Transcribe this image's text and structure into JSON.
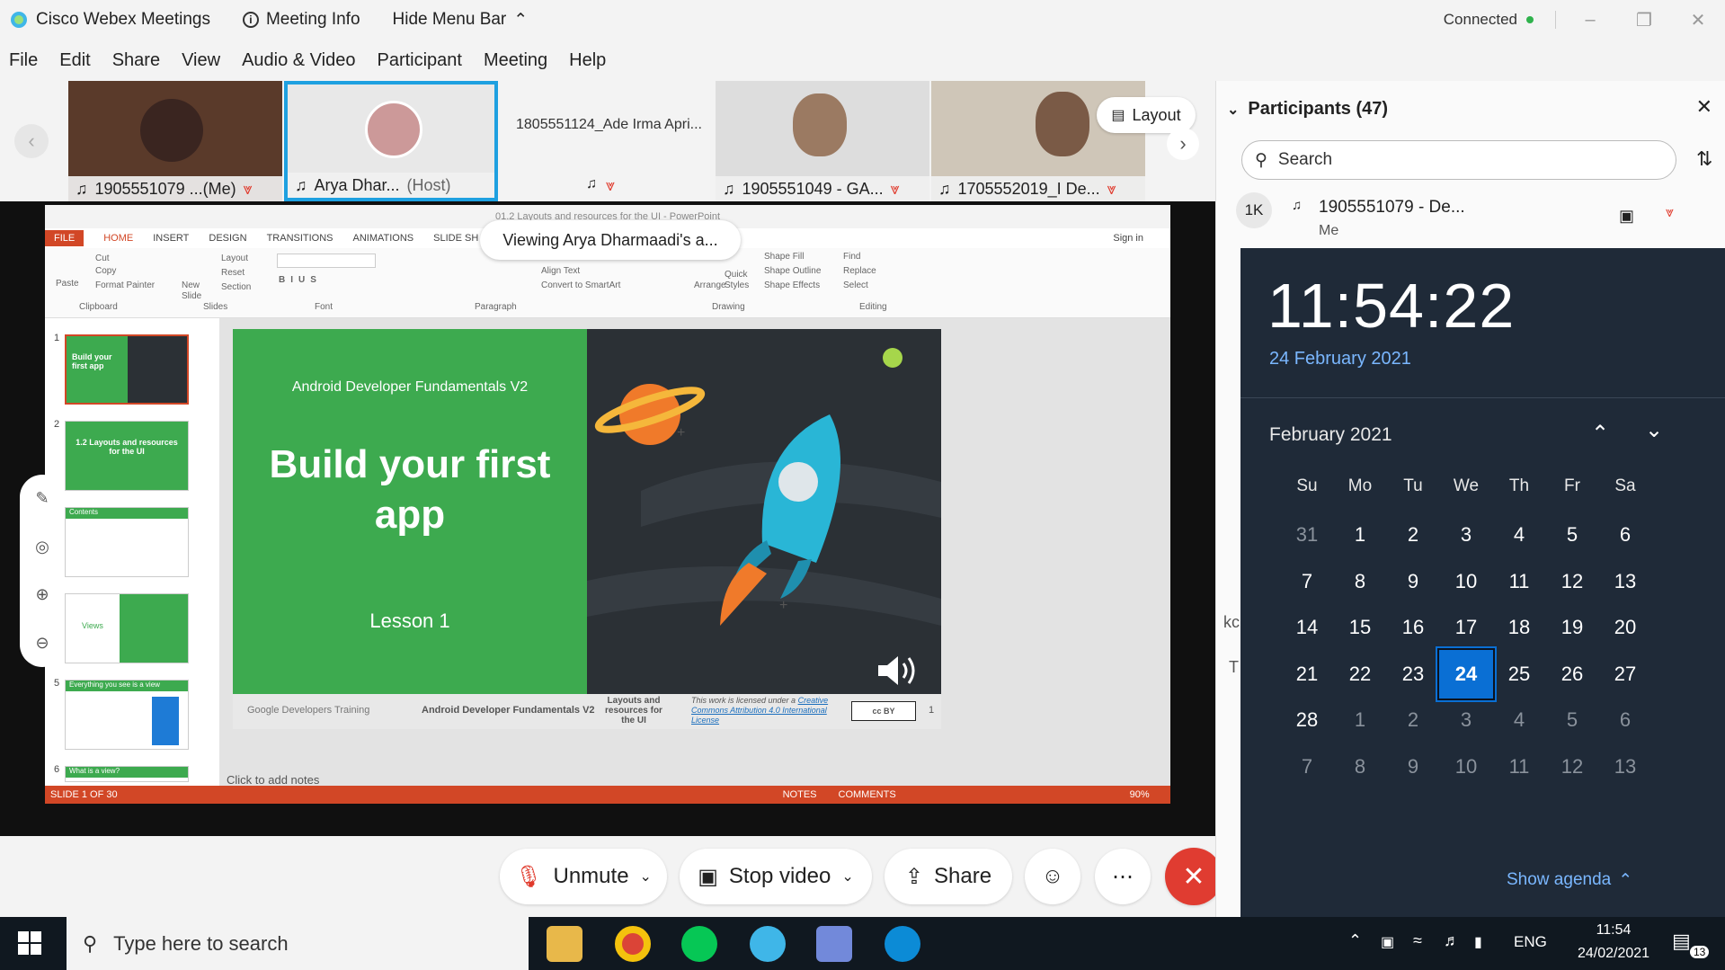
{
  "titlebar": {
    "app_name": "Cisco Webex Meetings",
    "meeting_info": "Meeting Info",
    "hide_menu": "Hide Menu Bar",
    "status": "Connected",
    "status_color": "#2fb24c"
  },
  "menubar": {
    "items": [
      "File",
      "Edit",
      "Share",
      "View",
      "Audio & Video",
      "Participant",
      "Meeting",
      "Help"
    ]
  },
  "videostrip": {
    "tiles": [
      {
        "name": "1905551079 ...(Me)",
        "muted": true
      },
      {
        "name": "Arya Dhar...",
        "role": "(Host)",
        "muted": false,
        "active": true
      },
      {
        "name": "1805551124_Ade Irma Apri...",
        "muted": true,
        "no_video": true
      },
      {
        "name": "1905551049 - GA...",
        "muted": true
      },
      {
        "name": "1705552019_I De...",
        "muted": true
      }
    ],
    "layout_label": "Layout"
  },
  "viewing_banner": "Viewing Arya Dharmaadi's a...",
  "ppt": {
    "window_title": "01.2 Layouts and resources for the UI - PowerPoint",
    "signin": "Sign in",
    "tabs": [
      "FILE",
      "HOME",
      "INSERT",
      "DESIGN",
      "TRANSITIONS",
      "ANIMATIONS",
      "SLIDE SH"
    ],
    "groups": {
      "clipboard": "Clipboard",
      "slides": "Slides",
      "font": "Font",
      "paragraph": "Paragraph",
      "drawing": "Drawing",
      "editing": "Editing"
    },
    "clipboard_items": {
      "paste": "Paste",
      "cut": "Cut",
      "copy": "Copy",
      "format_painter": "Format Painter"
    },
    "slides_items": {
      "new_slide": "New Slide",
      "layout": "Layout",
      "reset": "Reset",
      "section": "Section"
    },
    "paragraph_items": {
      "align_text": "Align Text",
      "convert_smartart": "Convert to SmartArt"
    },
    "drawing_items": {
      "arrange": "Arrange",
      "quick_styles": "Quick Styles",
      "shape_fill": "Shape Fill",
      "shape_outline": "Shape Outline",
      "shape_effects": "Shape Effects"
    },
    "editing_items": {
      "find": "Find",
      "replace": "Replace",
      "select": "Select"
    },
    "slide": {
      "course": "Android Developer Fundamentals V2",
      "title_line1": "Build your first",
      "title_line2": "app",
      "lesson": "Lesson 1",
      "footer_brand": "Google Developers Training",
      "footer_course": "Android Developer Fundamentals V2",
      "footer_topic": "Layouts and resources for the UI",
      "footer_license_prefix": "This work is licensed under a",
      "footer_license_link": "Creative Commons Attribution 4.0 International License",
      "page_number": "1"
    },
    "thumbs": [
      {
        "num": "1",
        "title": "Build your first app"
      },
      {
        "num": "2",
        "title": "1.2 Layouts and resources for the UI"
      },
      {
        "num": "",
        "title": "Contents"
      },
      {
        "num": "",
        "title": "Views"
      },
      {
        "num": "5",
        "title": "Everything you see is a view"
      },
      {
        "num": "6",
        "title": "What is a view?"
      }
    ],
    "notes_placeholder": "Click to add notes",
    "status": {
      "slide_of": "SLIDE 1 OF 30",
      "notes": "NOTES",
      "comments": "COMMENTS",
      "zoom": "90%"
    }
  },
  "controls": {
    "unmute": "Unmute",
    "stop_video": "Stop video",
    "share": "Share",
    "leave_color": "#e03c31"
  },
  "participants": {
    "header": "Participants (47)",
    "search_placeholder": "Search",
    "first": {
      "initials": "1K",
      "name": "1905551079 - De...",
      "sub": "Me"
    },
    "partial_texts": [
      "kc",
      "T"
    ]
  },
  "calendar": {
    "time": "11:54:22",
    "date": "24 February 2021",
    "month": "February 2021",
    "weekdays": [
      "Su",
      "Mo",
      "Tu",
      "We",
      "Th",
      "Fr",
      "Sa"
    ],
    "weeks": [
      [
        "31",
        "1",
        "2",
        "3",
        "4",
        "5",
        "6"
      ],
      [
        "7",
        "8",
        "9",
        "10",
        "11",
        "12",
        "13"
      ],
      [
        "14",
        "15",
        "16",
        "17",
        "18",
        "19",
        "20"
      ],
      [
        "21",
        "22",
        "23",
        "24",
        "25",
        "26",
        "27"
      ],
      [
        "28",
        "1",
        "2",
        "3",
        "4",
        "5",
        "6"
      ],
      [
        "7",
        "8",
        "9",
        "10",
        "11",
        "12",
        "13"
      ]
    ],
    "selected": "24",
    "show_agenda": "Show agenda"
  },
  "taskbar": {
    "search_placeholder": "Type here to search",
    "lang": "ENG",
    "time": "11:54",
    "date": "24/02/2021",
    "notif_count": "13"
  }
}
